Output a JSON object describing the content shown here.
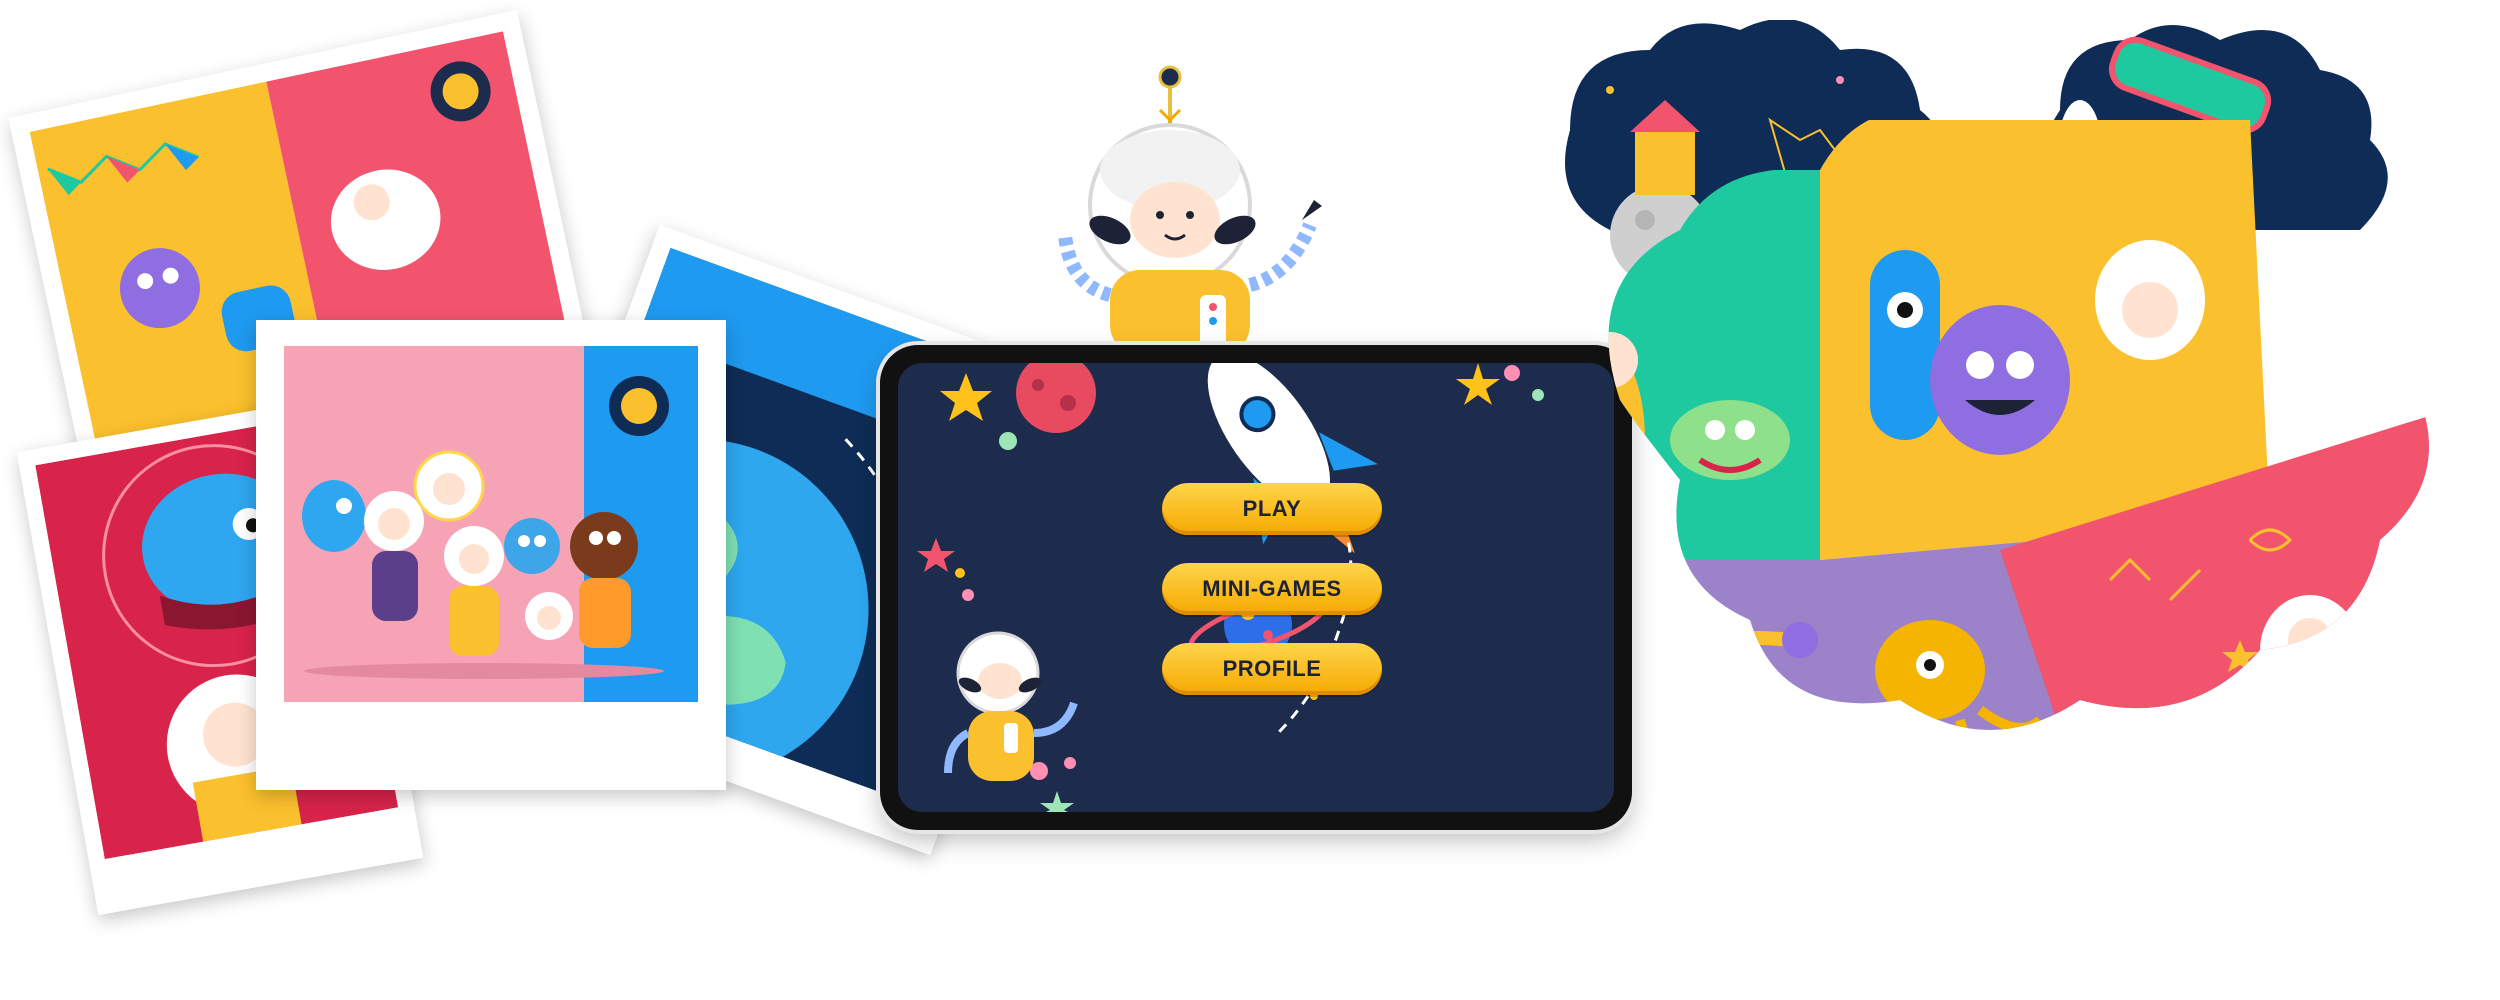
{
  "menu": {
    "play_label": "PLAY",
    "mini_games_label": "MINI-GAMES",
    "profile_label": "PROFILE"
  },
  "icons": {
    "rocket": "rocket-icon",
    "planet": "planet-icon",
    "star": "star-icon",
    "earth": "earth-icon",
    "moon": "moon-icon"
  },
  "colors": {
    "screen_bg": "#1d2b4c",
    "button_yellow": "#ffc21a",
    "button_text": "#1d2236",
    "pink": "#f2546e",
    "yellow": "#fbc02d",
    "blue": "#1e9af0",
    "green": "#1ec9a0",
    "purple": "#9c82c8",
    "navy": "#0e2c55"
  }
}
